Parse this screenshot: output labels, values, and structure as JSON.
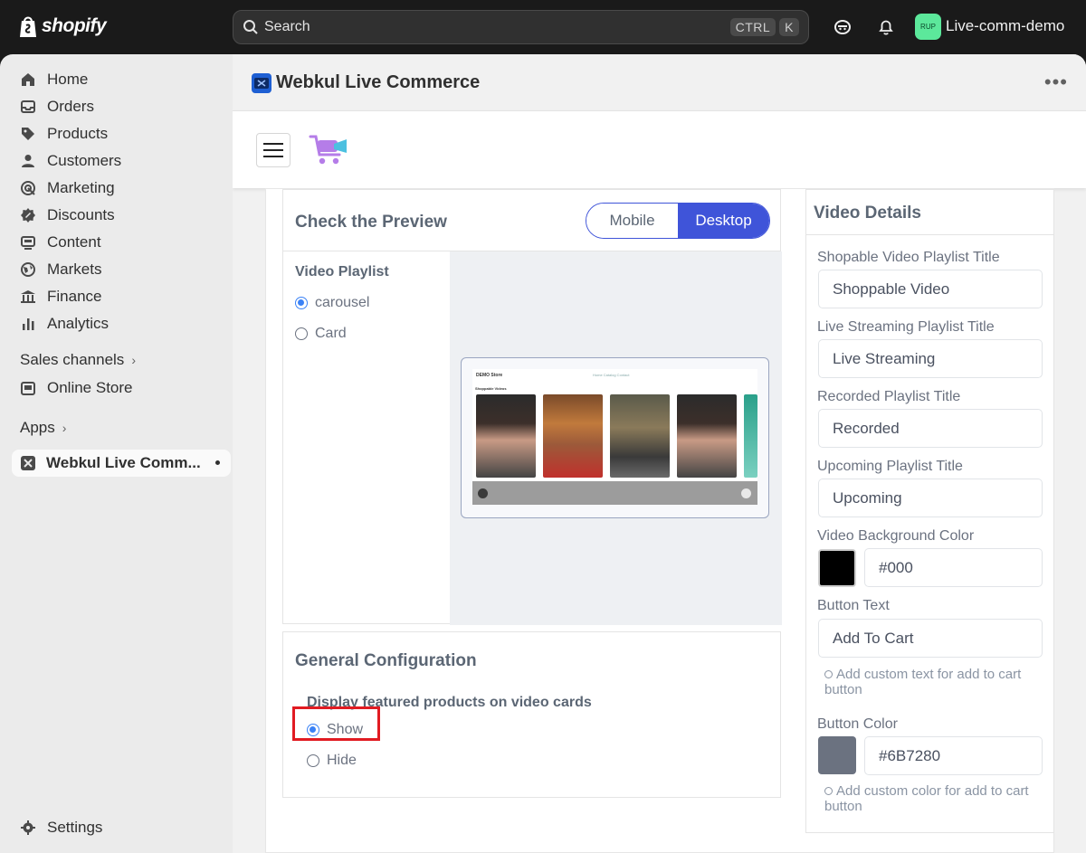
{
  "topbar": {
    "logo_text": "shopify",
    "search_placeholder": "Search",
    "shortcut_keys": [
      "CTRL",
      "K"
    ],
    "store_badge": "RUP",
    "store_name": "Live-comm-demo"
  },
  "sidebar": {
    "items": [
      {
        "label": "Home",
        "icon": "home-icon"
      },
      {
        "label": "Orders",
        "icon": "inbox-icon"
      },
      {
        "label": "Products",
        "icon": "tag-icon"
      },
      {
        "label": "Customers",
        "icon": "person-icon"
      },
      {
        "label": "Marketing",
        "icon": "target-icon"
      },
      {
        "label": "Discounts",
        "icon": "discount-icon"
      },
      {
        "label": "Content",
        "icon": "content-icon"
      },
      {
        "label": "Markets",
        "icon": "globe-icon"
      },
      {
        "label": "Finance",
        "icon": "bank-icon"
      },
      {
        "label": "Analytics",
        "icon": "bar-chart-icon"
      }
    ],
    "sales_channels_label": "Sales channels",
    "online_store_label": "Online Store",
    "apps_label": "Apps",
    "active_app_label": "Webkul Live Comm...",
    "settings_label": "Settings"
  },
  "app_header": {
    "title": "Webkul Live Commerce",
    "more_label": "•••"
  },
  "preview": {
    "title": "Check the Preview",
    "toggle": {
      "mobile": "Mobile",
      "desktop": "Desktop",
      "selected": "Desktop"
    },
    "playlist_title": "Video Playlist",
    "playlist_options": [
      "carousel",
      "Card"
    ],
    "playlist_selected": "carousel",
    "mini_store_name": "DEMO Store",
    "mini_links": "Home   Catalog   Contact",
    "mini_section": "Shoppable Videos"
  },
  "general": {
    "title": "General Configuration",
    "featured_label": "Display featured products on video cards",
    "options": [
      "Show",
      "Hide"
    ],
    "selected": "Show"
  },
  "video_details": {
    "title": "Video Details",
    "shoppable_label": "Shopable Video Playlist Title",
    "shoppable_value": "Shoppable Video",
    "live_label": "Live Streaming Playlist Title",
    "live_value": "Live Streaming",
    "recorded_label": "Recorded Playlist Title",
    "recorded_value": "Recorded",
    "upcoming_label": "Upcoming Playlist Title",
    "upcoming_value": "Upcoming",
    "bg_color_label": "Video Background Color",
    "bg_color_value": "#000",
    "button_text_label": "Button Text",
    "button_text_value": "Add To Cart",
    "button_text_hint": "Add custom text for add to cart button",
    "button_color_label": "Button Color",
    "button_color_value": "#6B7280",
    "button_color_hint": "Add custom color for add to cart button"
  },
  "colors": {
    "accent": "#3f54d9",
    "radio": "#3b82f6",
    "highlight": "#e11b22",
    "bg_swatch": "#000000",
    "button_swatch": "#6B7280"
  }
}
